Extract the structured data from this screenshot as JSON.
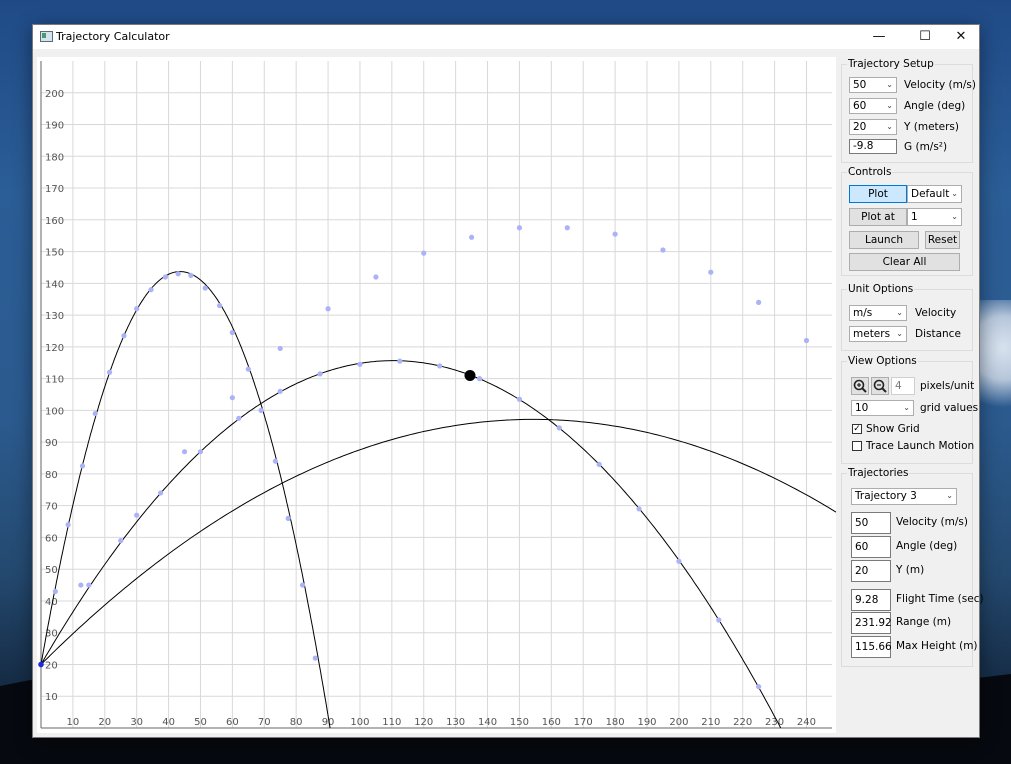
{
  "window": {
    "title": "Trajectory Calculator",
    "min_glyph": "—",
    "max_glyph": "☐",
    "close_glyph": "✕"
  },
  "colors": {
    "point": "#a9b3f5",
    "curve": "#000000",
    "origin": "#1b2be0",
    "grid": "#d8d8d8"
  },
  "chart_data": {
    "type": "line",
    "grid": true,
    "xlim": [
      0,
      248
    ],
    "ylim": [
      0,
      210
    ],
    "x_ticks": [
      10,
      20,
      30,
      40,
      50,
      60,
      70,
      80,
      90,
      100,
      110,
      120,
      130,
      140,
      150,
      160,
      170,
      180,
      190,
      200,
      210,
      220,
      230,
      240
    ],
    "y_ticks": [
      10,
      20,
      30,
      40,
      50,
      60,
      70,
      80,
      90,
      100,
      110,
      120,
      130,
      140,
      150,
      160,
      170,
      180,
      190,
      200
    ],
    "origin": {
      "x": 0,
      "y": 20
    },
    "marker": {
      "x": 134.5,
      "y": 111
    },
    "series": [
      {
        "velocity": 50,
        "angle": 80,
        "y0": 20,
        "g": 9.8,
        "points": [
          [
            4.5,
            43
          ],
          [
            8.5,
            64
          ],
          [
            13,
            82.5
          ],
          [
            17,
            99
          ],
          [
            21.5,
            112
          ],
          [
            26,
            123.5
          ],
          [
            30,
            132
          ],
          [
            34.5,
            138
          ],
          [
            39,
            142
          ],
          [
            43,
            143
          ],
          [
            47,
            142.5
          ],
          [
            51.5,
            138.5
          ],
          [
            56,
            133
          ],
          [
            60,
            124.5
          ],
          [
            65,
            113
          ],
          [
            69,
            100
          ],
          [
            73.5,
            84
          ],
          [
            77.5,
            66
          ],
          [
            82,
            45
          ],
          [
            86,
            22
          ]
        ]
      },
      {
        "velocity": 50,
        "angle": 60,
        "y0": 20,
        "g": 9.8,
        "points": [
          [
            12.5,
            45
          ],
          [
            25,
            59
          ],
          [
            37.5,
            74
          ],
          [
            50,
            87
          ],
          [
            62,
            97.5
          ],
          [
            75,
            106
          ],
          [
            87.5,
            111.5
          ],
          [
            100,
            114.5
          ],
          [
            112.5,
            115.5
          ],
          [
            125,
            114
          ],
          [
            137.5,
            110
          ],
          [
            150,
            103.5
          ],
          [
            162.5,
            94.5
          ],
          [
            175,
            83
          ],
          [
            187.5,
            69
          ],
          [
            200,
            52.5
          ],
          [
            212.5,
            34
          ],
          [
            225,
            13
          ]
        ]
      },
      {
        "velocity": 55,
        "angle": 45,
        "y0": 20,
        "g": 9.8,
        "points": [
          [
            15,
            45
          ],
          [
            30,
            67
          ],
          [
            45,
            87
          ],
          [
            60,
            104
          ],
          [
            75,
            119.5
          ],
          [
            90,
            132
          ],
          [
            105,
            142
          ],
          [
            120,
            149.5
          ],
          [
            135,
            154.5
          ],
          [
            150,
            157.5
          ],
          [
            165,
            157.5
          ],
          [
            180,
            155.5
          ],
          [
            195,
            150.5
          ],
          [
            210,
            143.5
          ],
          [
            225,
            134
          ],
          [
            240,
            122
          ]
        ]
      }
    ]
  },
  "setup": {
    "title": "Trajectory Setup",
    "velocity": {
      "value": "50",
      "label": "Velocity (m/s)"
    },
    "angle": {
      "value": "60",
      "label": "Angle (deg)"
    },
    "y": {
      "value": "20",
      "label": "Y (meters)"
    },
    "g": {
      "value": "-9.8",
      "label": "G (m/s²)"
    }
  },
  "controls": {
    "title": "Controls",
    "plot": "Plot",
    "plot_mode": "Default",
    "plot_at": "Plot at",
    "plot_at_value": "1",
    "launch": "Launch",
    "reset": "Reset",
    "clear_all": "Clear All"
  },
  "units": {
    "title": "Unit Options",
    "velocity_unit": "m/s",
    "velocity_label": "Velocity",
    "distance_unit": "meters",
    "distance_label": "Distance"
  },
  "view": {
    "title": "View Options",
    "pixels_value": "4",
    "pixels_label": "pixels/unit",
    "grid_value": "10",
    "grid_label": "grid values",
    "show_grid": "Show Grid",
    "show_grid_checked": true,
    "trace": "Trace Launch Motion",
    "trace_checked": false
  },
  "trajectories": {
    "title": "Trajectories",
    "selected": "Trajectory 3",
    "velocity": {
      "value": "50",
      "label": "Velocity (m/s)"
    },
    "angle": {
      "value": "60",
      "label": "Angle (deg)"
    },
    "y": {
      "value": "20",
      "label": "Y (m)"
    },
    "flight_time": {
      "value": "9.28",
      "label": "Flight Time (sec)"
    },
    "range": {
      "value": "231.92",
      "label": "Range (m)"
    },
    "max_height": {
      "value": "115.66",
      "label": "Max Height (m)"
    }
  }
}
